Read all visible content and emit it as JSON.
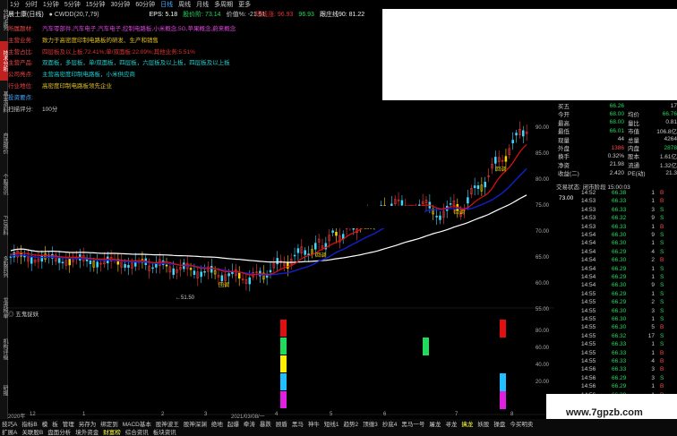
{
  "left_tabs": [
    "分时走势",
    "技术分析",
    "基本资料",
    "自选报价",
    "个股资讯",
    "F10资料",
    "多股同列",
    "龙虎榜单",
    "机构评级",
    "研报"
  ],
  "periods": [
    "1分",
    "分时",
    "1分钟",
    "5分钟",
    "15分钟",
    "30分钟",
    "60分钟",
    "日线",
    "周线",
    "月线",
    "多周期",
    "更多"
  ],
  "active_period": "日线",
  "title": {
    "name": "晨士康(日线)",
    "ma": "● CWDD(20,7,79)",
    "eps_label": "EPS: 5.18",
    "pe_label": "股价阶: 73.14",
    "value_label": "价值%: -21.51",
    "r1": "短线涨: 96.93",
    "r2": "96.93",
    "r3": "跟庄线90: 81.22"
  },
  "info": [
    {
      "label": "所属题材:",
      "text": "汽车零部件,汽车电子,汽车电子,控制电路板,小米概念,5G,苹果概念,蔚来概念",
      "color": "#e040e0"
    },
    {
      "label": "主营业务:",
      "text": "致力于高密度印制电路板的研发、生产和销售",
      "color": "#e0c020"
    },
    {
      "label": "主营占比:",
      "text": "四层板及以上板:72.41%;单/双面板:22.09%;其他业务:5.51%",
      "color": "#e03030"
    },
    {
      "label": "主营产品:",
      "text": "双面板，多层板，单/双面板，四层板，六层板及以上板，四层板及以上板",
      "color": "#20d0d0"
    },
    {
      "label": "公司亮点:",
      "text": "主营高密度印制电路板，小米供应商",
      "color": "#20d0d0"
    },
    {
      "label": "行业地位:",
      "text": "高密度印制电路板领先企业",
      "color": "#e0c020"
    },
    {
      "label": "投资要点:",
      "text": "",
      "color": "#4aa8ff"
    },
    {
      "label": "扫描评分:",
      "text": "100分",
      "color": "#cccccc"
    }
  ],
  "quote": {
    "rows": [
      {
        "k": "买五",
        "v": "66.26",
        "c": "#21d95c",
        "k2": "",
        "v2": "17",
        "c2": "#cccccc"
      },
      {
        "k": "今开",
        "v": "68.00",
        "c": "#21d95c",
        "k2": "均价",
        "v2": "66.76",
        "c2": "#21d95c"
      },
      {
        "k": "最高",
        "v": "68.00",
        "c": "#21d95c",
        "k2": "量比",
        "v2": "0.81",
        "c2": "#cccccc"
      },
      {
        "k": "最低",
        "v": "66.01",
        "c": "#21d95c",
        "k2": "市值",
        "v2": "106.8亿",
        "c2": "#cccccc"
      },
      {
        "k": "现量",
        "v": "44",
        "c": "#cccccc",
        "k2": "总量",
        "v2": "4264",
        "c2": "#cccccc"
      },
      {
        "k": "外盘",
        "v": "1386",
        "c": "#ff4444",
        "k2": "内盘",
        "v2": "2878",
        "c2": "#21d95c"
      },
      {
        "k": "换手",
        "v": "0.32%",
        "c": "#cccccc",
        "k2": "股本",
        "v2": "1.61亿",
        "c2": "#cccccc"
      },
      {
        "k": "净资",
        "v": "21.98",
        "c": "#cccccc",
        "k2": "流通",
        "v2": "1.32亿",
        "c2": "#cccccc"
      },
      {
        "k": "收益(二)",
        "v": "2.420",
        "c": "#cccccc",
        "k2": "PE(动)",
        "v2": "21.3",
        "c2": "#cccccc"
      }
    ],
    "status": "交易状态: 闭市阶段 15:00:03",
    "last_price": "73.00",
    "ticks": [
      [
        "14:52",
        "66.38",
        "1",
        "B"
      ],
      [
        "14:53",
        "66.33",
        "1",
        "B"
      ],
      [
        "14:53",
        "66.33",
        "3",
        "S"
      ],
      [
        "14:53",
        "66.32",
        "9",
        "S"
      ],
      [
        "14:53",
        "66.33",
        "1",
        "B"
      ],
      [
        "14:54",
        "66.30",
        "9",
        "S"
      ],
      [
        "14:54",
        "66.30",
        "1",
        "S"
      ],
      [
        "14:54",
        "66.29",
        "4",
        "S"
      ],
      [
        "14:54",
        "66.30",
        "2",
        "B"
      ],
      [
        "14:54",
        "66.29",
        "1",
        "S"
      ],
      [
        "14:54",
        "66.29",
        "1",
        "S"
      ],
      [
        "14:54",
        "66.30",
        "9",
        "S"
      ],
      [
        "14:55",
        "66.29",
        "1",
        "S"
      ],
      [
        "14:55",
        "66.29",
        "2",
        "S"
      ],
      [
        "14:55",
        "66.30",
        "3",
        "S"
      ],
      [
        "14:55",
        "66.30",
        "1",
        "S"
      ],
      [
        "14:55",
        "66.30",
        "5",
        "B"
      ],
      [
        "14:55",
        "66.32",
        "17",
        "S"
      ],
      [
        "14:55",
        "66.33",
        "1",
        "S"
      ],
      [
        "14:55",
        "66.33",
        "1",
        "B"
      ],
      [
        "14:55",
        "66.33",
        "4",
        "B"
      ],
      [
        "14:56",
        "66.33",
        "3",
        "B"
      ],
      [
        "14:56",
        "66.29",
        "3",
        "S"
      ],
      [
        "14:56",
        "66.29",
        "1",
        "B"
      ],
      [
        "14:56",
        "66.29",
        "1",
        "B"
      ],
      [
        "14:56",
        "66.29",
        "3",
        "S"
      ],
      [
        "14:56",
        "66.29",
        "1",
        "B"
      ],
      [
        "14:56",
        "66.29",
        "8",
        "S"
      ],
      [
        "14:56",
        "66.29",
        "1",
        "B"
      ],
      [
        "14:56",
        "66.28",
        "3",
        "B"
      ],
      [
        "14:56",
        "66.28",
        "1",
        "S"
      ]
    ]
  },
  "price_axis": [
    "90.00",
    "85.00",
    "80.00",
    "75.00",
    "70.00",
    "65.00",
    "60.00",
    "55.00"
  ],
  "low_mark": "←51.50",
  "sub_title": "◎ 五鬼捉妖",
  "sub_axis": [
    "80.00",
    "60.00",
    "40.00",
    "20.00"
  ],
  "date_axis": [
    "2020年",
    "12",
    "1",
    "2",
    "3",
    "2021/03/08/一",
    "4",
    "5",
    "6",
    "7",
    "8"
  ],
  "candle_labels": {
    "buy": "回调",
    "hold": "加"
  },
  "bottom_row1": [
    "技巧A",
    "指标B",
    "模",
    "板",
    "管理",
    "另存为",
    "绑定到",
    "MACD基本",
    "股神波王",
    "股神深渊",
    "绝地",
    "起爆",
    "牵涛",
    "暴跌",
    "顾盾",
    "黑马",
    "神牛",
    "短线1",
    "趋势2",
    "顶缠3",
    "抄底4",
    "黑马一号",
    "屠龙",
    "寻龙",
    "擒龙",
    "妖股",
    "操盘",
    "今买明卖"
  ],
  "bottom_row2": [
    "扩展A",
    "关联股B",
    "盘面分析",
    "境外资金",
    "财富榜",
    "综合资讯",
    "板块资讯"
  ],
  "watermark": "www.7gpzb.com"
}
